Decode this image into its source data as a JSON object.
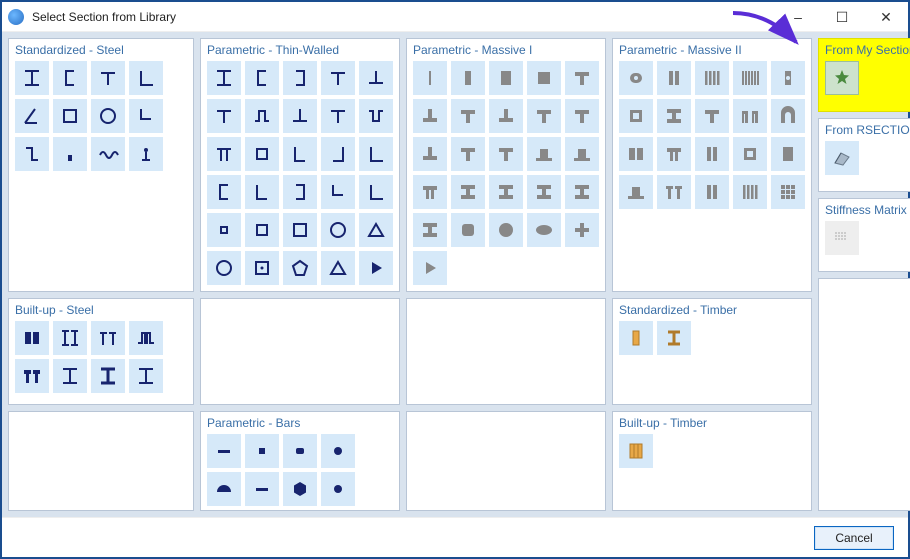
{
  "window": {
    "title": "Select Section from Library",
    "buttons": {
      "min": "–",
      "max": "☐",
      "close": "✕"
    }
  },
  "footer": {
    "cancel": "Cancel"
  },
  "panels": {
    "std_steel": {
      "title": "Standardized - Steel",
      "color": "#17246e",
      "iconbg": "#d6e9f9",
      "icons": [
        "Ibeam",
        "Cchan",
        "Tsection",
        "Langle",
        "angle",
        "rect-tube",
        "circ-tube",
        "Lshape2",
        "Zshape",
        "base",
        "wave",
        "dot-head"
      ]
    },
    "thin_walled": {
      "title": "Parametric - Thin-Walled",
      "color": "#17246e",
      "iconbg": "#d6e9f9",
      "icons": [
        "Ibeam",
        "Cchan",
        "Cchan-r",
        "Tsection",
        "Tsection-r",
        "Tsection",
        "hat",
        "Tsection-r",
        "Tsection",
        "hat-r",
        "pi",
        "box",
        "Lshape",
        "Lshape-r",
        "Langle",
        "Cchan",
        "Lshape",
        "Cchan-r",
        "Lshape2",
        "Langle",
        "small-box",
        "box",
        "rect-tube",
        "circ-tube",
        "triangle",
        "circle-out",
        "box-dots",
        "pentagon",
        "triangle",
        "play"
      ]
    },
    "massive1": {
      "title": "Parametric - Massive I",
      "color": "#888",
      "iconbg": "#d6e9f9",
      "icons": [
        "bar-th",
        "bar",
        "bar-wide",
        "square",
        "Tmass",
        "Tmass-r",
        "Tmass",
        "Tmass-r",
        "Tmass",
        "Tmass",
        "Tmass-r",
        "Tmass",
        "Tmass",
        "hat-mass",
        "hat-mass",
        "pi-mass",
        "Imass",
        "Imass",
        "Imass",
        "Imass",
        "Imass",
        "rrect",
        "circle",
        "ellipse",
        "cross",
        "play"
      ]
    },
    "massive2": {
      "title": "Parametric - Massive II",
      "color": "#888",
      "iconbg": "#d6e9f9",
      "icons": [
        "o-slot",
        "bars2",
        "bars4",
        "bars6",
        "bar-hole",
        "box-h",
        "Imass",
        "Tmass",
        "arch2",
        "arch",
        "box2",
        "pi-mass",
        "bars2",
        "box-h",
        "bar-wide",
        "hat-mass",
        "double-t",
        "bars2",
        "bars4",
        "grid9"
      ]
    },
    "builtup_steel": {
      "title": "Built-up - Steel",
      "color": "#17246e",
      "iconbg": "#d6e9f9",
      "icons": [
        "box2",
        "Ibeam2",
        "Tsection2",
        "hat2",
        "Tmass2",
        "Ibeam",
        "Ibeam-th",
        "Ibeam"
      ]
    },
    "std_timber": {
      "title": "Standardized - Timber",
      "color": "#d8a24a",
      "iconbg": "#d6e9f9",
      "icons": [
        "timber",
        "timber-i"
      ]
    },
    "bars": {
      "title": "Parametric - Bars",
      "color": "#17246e",
      "iconbg": "#d6e9f9",
      "icons": [
        "bar-flat",
        "square-sm",
        "rrect-sm",
        "circle-sm",
        "half",
        "bar-flat",
        "hex",
        "circle-sm"
      ]
    },
    "builtup_timber": {
      "title": "Built-up - Timber",
      "color": "#d8a24a",
      "iconbg": "#d6e9f9",
      "icons": [
        "timber-wide"
      ]
    },
    "my_sections": {
      "title": "From My Sections",
      "color": "#4a8a3e",
      "iconbg": "#cde2cc",
      "icons": [
        "star"
      ]
    },
    "rsection": {
      "title": "From RSECTION",
      "color": "#888",
      "iconbg": "#d6e9f9",
      "icons": [
        "rsec"
      ]
    },
    "stiffness": {
      "title": "Stiffness Matrix",
      "color": "#bbb",
      "iconbg": "#eeeeee",
      "icons": [
        "matrix"
      ]
    }
  }
}
